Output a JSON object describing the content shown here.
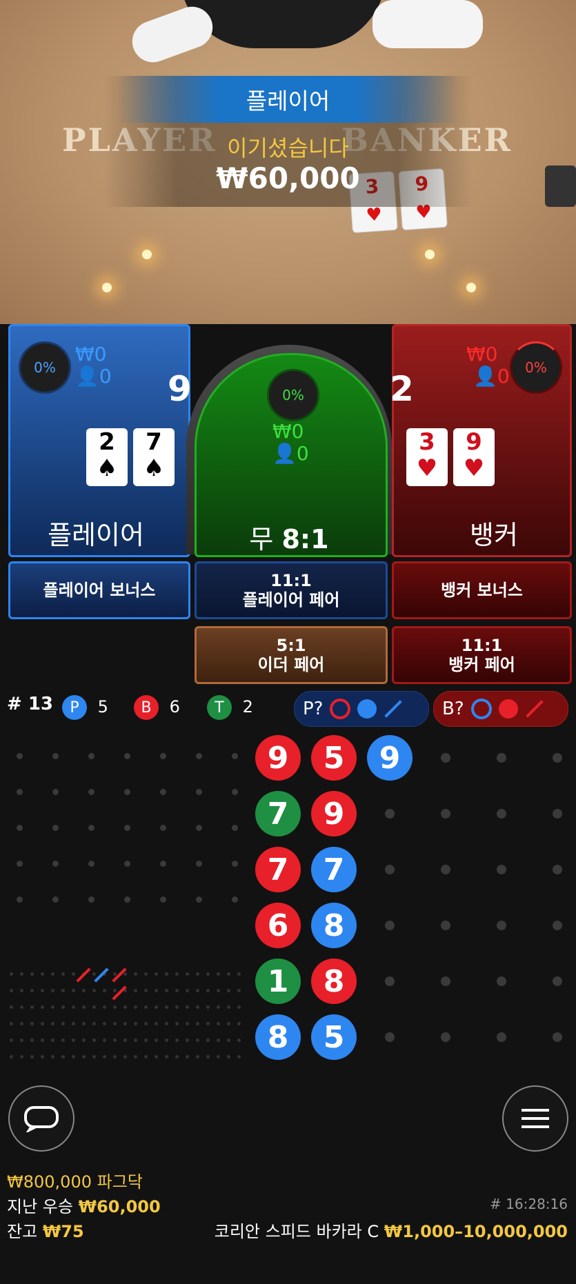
{
  "video": {
    "table_left": "PLAYER",
    "table_right": "BANKER"
  },
  "win_banner": {
    "title": "플레이어",
    "subtitle": "이기셨습니다",
    "amount": "₩60,000"
  },
  "player_panel": {
    "percent": "0%",
    "bet_amount": "₩0",
    "players": "0",
    "score": "9",
    "cards": [
      {
        "rank": "2",
        "suit": "♠"
      },
      {
        "rank": "7",
        "suit": "♠"
      }
    ],
    "label": "플레이어"
  },
  "tie_panel": {
    "percent": "0%",
    "bet_amount": "₩0",
    "players": "0",
    "label": "무",
    "odds": "8:1"
  },
  "banker_panel": {
    "percent": "0%",
    "bet_amount": "₩0",
    "players": "0",
    "score": "2",
    "cards": [
      {
        "rank": "3",
        "suit": "♥"
      },
      {
        "rank": "9",
        "suit": "♥"
      }
    ],
    "label": "뱅커"
  },
  "side_bets": {
    "player_bonus": "플레이어 보너스",
    "player_pair_odds": "11:1",
    "player_pair": "플레이어 페어",
    "banker_bonus": "뱅커 보너스",
    "either_pair_odds": "5:1",
    "either_pair": "이더 페어",
    "banker_pair_odds": "11:1",
    "banker_pair": "뱅커 페어"
  },
  "stats": {
    "round": "# 13",
    "p_chip": "P",
    "p_count": "5",
    "b_chip": "B",
    "b_count": "6",
    "t_chip": "T",
    "t_count": "2",
    "p_predict": "P?",
    "b_predict": "B?"
  },
  "bead_road": [
    [
      {
        "v": "9",
        "c": "red"
      },
      {
        "v": "5",
        "c": "red"
      },
      {
        "v": "9",
        "c": "blue"
      }
    ],
    [
      {
        "v": "7",
        "c": "green"
      },
      {
        "v": "9",
        "c": "red"
      }
    ],
    [
      {
        "v": "7",
        "c": "red"
      },
      {
        "v": "7",
        "c": "blue"
      }
    ],
    [
      {
        "v": "6",
        "c": "red"
      },
      {
        "v": "8",
        "c": "blue"
      }
    ],
    [
      {
        "v": "1",
        "c": "green"
      },
      {
        "v": "8",
        "c": "red"
      }
    ],
    [
      {
        "v": "8",
        "c": "blue"
      },
      {
        "v": "5",
        "c": "blue"
      }
    ]
  ],
  "colors": {
    "player_blue": "#2d86f2",
    "banker_red": "#e8202a",
    "tie_green": "#1f8f43",
    "gold": "#f3c742"
  },
  "footer": {
    "jackpot_amount": "₩800,000",
    "jackpot_label": "파그닥",
    "last_win_label": "지난 우승",
    "last_win_amount": "₩60,000",
    "balance_label": "잔고",
    "balance_amount": "₩75",
    "round_time": "# 16:28:16",
    "table_name": "코리안 스피드 바카라 C",
    "bet_limits": "₩1,000–10,000,000"
  },
  "icons": {
    "left_button": "chat-bubble-icon",
    "right_button": "menu-icon"
  }
}
